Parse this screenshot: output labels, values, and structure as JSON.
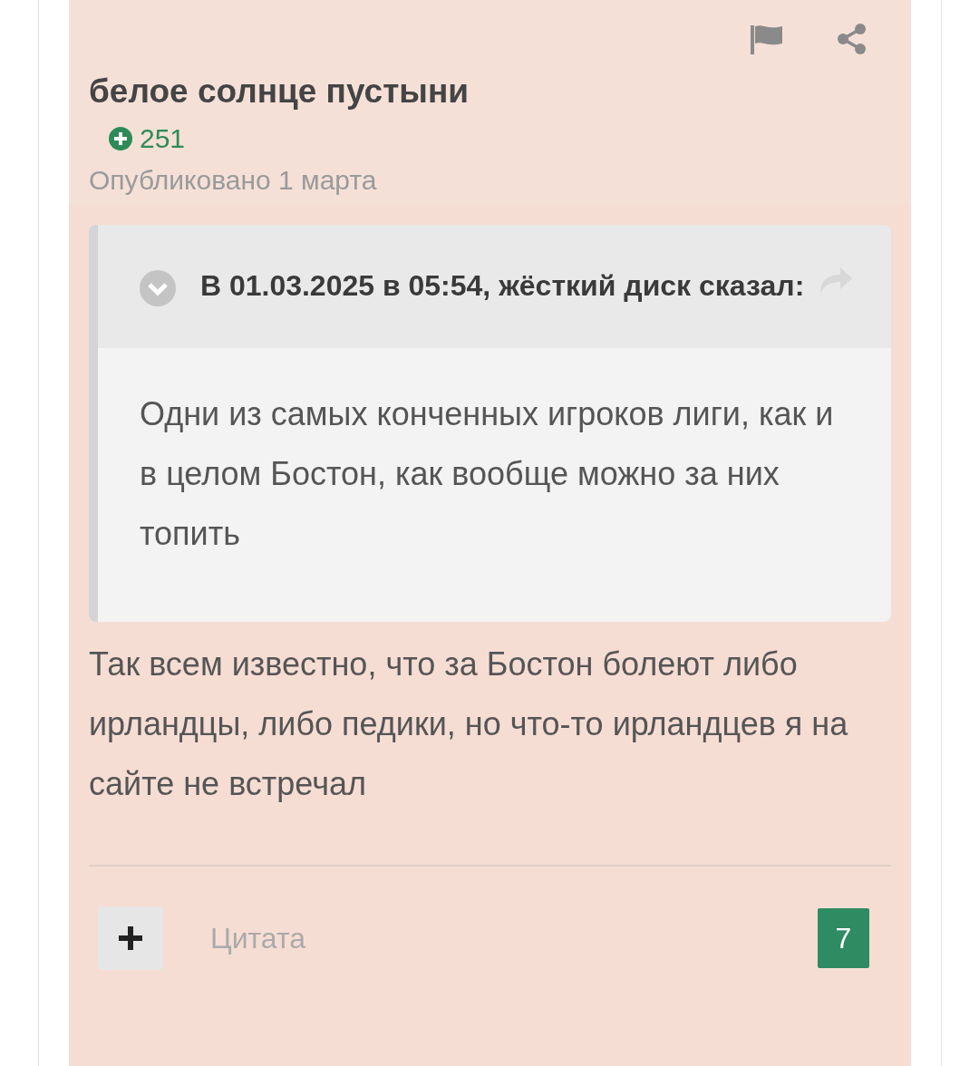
{
  "post": {
    "author": "белое солнце пустыни",
    "reputation": "251",
    "date": "Опубликовано 1 марта",
    "quote": {
      "citation": "В 01.03.2025 в 05:54, жёсткий диск сказал:",
      "text": "Одни из самых конченных игроков лиги, как и в целом Бостон, как вообще можно за них топить"
    },
    "text": "Так всем известно, что за Бостон болеют либо ирландцы, либо педики, но что-то ирландцев я на сайте не встречал",
    "quote_button": "Цитата",
    "reaction_count": "7"
  }
}
